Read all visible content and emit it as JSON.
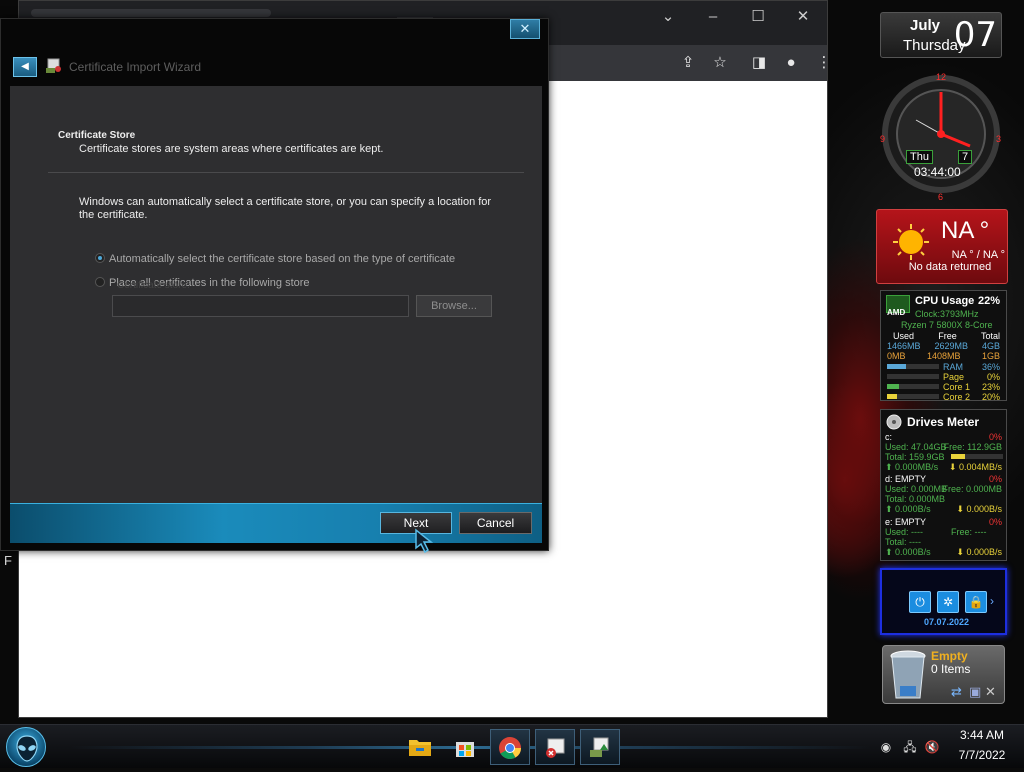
{
  "desktop": {
    "edge_letter": "F"
  },
  "wizard": {
    "title": "Certificate Import Wizard",
    "close_symbol": "✕",
    "back_symbol": "◀",
    "section_title": "Certificate Store",
    "section_desc": "Certificate stores are system areas where certificates are kept.",
    "intro": "Windows can automatically select a certificate store, or you can specify a location for the certificate.",
    "options": [
      {
        "label": "Automatically select the certificate store based on the type of certificate",
        "selected": true
      },
      {
        "label": "Place all certificates in the following store",
        "selected": false
      }
    ],
    "store_label": "Certificate store:",
    "store_value": "",
    "browse_label": "Browse...",
    "next_label": "Next",
    "cancel_label": "Cancel"
  },
  "gadgets": {
    "date": {
      "month": "July",
      "weekday": "Thursday",
      "day": "07"
    },
    "clock": {
      "day_badge": "Thu",
      "date_badge": "7",
      "time": "03:44:00",
      "numerals": [
        "12",
        "3",
        "6",
        "9"
      ]
    },
    "weather": {
      "temp": "NA °",
      "range": "NA ° / NA °",
      "message": "No data returned"
    },
    "cpu": {
      "brand": "AMD",
      "title": "CPU Usage",
      "usage": "22%",
      "clock": "Clock:3793MHz",
      "model": "Ryzen 7 5800X 8-Core",
      "headers": [
        "Used",
        "Free",
        "Total"
      ],
      "ram_row": [
        "1466MB",
        "2629MB",
        "4GB"
      ],
      "page_row": [
        "0MB",
        "1408MB",
        "1GB"
      ],
      "bars": [
        {
          "label": "RAM",
          "value": "36%",
          "fraction": 0.36,
          "color": "#5aa8d8"
        },
        {
          "label": "Page",
          "value": "0%",
          "fraction": 0.0,
          "color": "#e8d23a"
        },
        {
          "label": "Core 1",
          "value": "23%",
          "fraction": 0.23,
          "color": "#4fb34f"
        },
        {
          "label": "Core 2",
          "value": "20%",
          "fraction": 0.2,
          "color": "#e8d23a"
        }
      ]
    },
    "drives": {
      "title": "Drives Meter",
      "c": {
        "name": "c:",
        "pct": "0%",
        "used": "Used: 47.04GB",
        "free": "Free: 112.9GB",
        "total": "Total: 159.9GB",
        "read": "0.000MB/s",
        "write": "0.004MB/s"
      },
      "d": {
        "name": "d: EMPTY",
        "pct": "0%",
        "used": "Used: 0.000MB",
        "free": "Free: 0.000MB",
        "total": "Total: 0.000MB",
        "read": "0.000B/s",
        "write": "0.000B/s"
      },
      "e": {
        "name": "e: EMPTY",
        "pct": "0%",
        "used": "Used: ----",
        "free": "Free: ----",
        "total": "Total: ----",
        "read": "0.000B/s",
        "write": "0.000B/s"
      }
    },
    "blue": {
      "date": "07.07.2022"
    },
    "recycle": {
      "state": "Empty",
      "count": "0 Items"
    }
  },
  "taskbar": {
    "time": "3:44 AM",
    "date": "7/7/2022"
  },
  "colors": {
    "accent": "#1a8bbb",
    "weather_red": "#b5141a",
    "gadget_green": "#4fb34f",
    "gadget_yellow": "#e8d23a"
  }
}
